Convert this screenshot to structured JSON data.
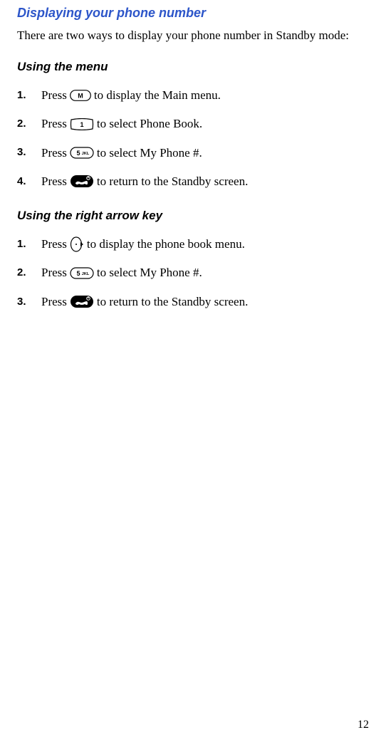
{
  "section": {
    "title": "Displaying your phone number",
    "intro": "There are two ways to display your phone number in Standby mode:"
  },
  "menu_method": {
    "heading": "Using the menu",
    "steps": [
      {
        "num": "1.",
        "pre": "Press ",
        "icon": "m-key",
        "post": " to display the Main menu."
      },
      {
        "num": "2.",
        "pre": "Press ",
        "icon": "key-1",
        "post": " to select Phone Book."
      },
      {
        "num": "3.",
        "pre": "Press ",
        "icon": "key-5jkl",
        "post": " to select My Phone #."
      },
      {
        "num": "4.",
        "pre": "Press ",
        "icon": "end-key",
        "post": " to return to the Standby screen."
      }
    ]
  },
  "arrow_method": {
    "heading": "Using the right arrow key",
    "steps": [
      {
        "num": "1.",
        "pre": "Press ",
        "icon": "right-arrow-key",
        "post": " to display the phone book menu."
      },
      {
        "num": "2.",
        "pre": "Press ",
        "icon": "key-5jkl",
        "post": " to select My Phone #."
      },
      {
        "num": "3.",
        "pre": "Press ",
        "icon": "end-key",
        "post": " to return to the Standby screen."
      }
    ]
  },
  "page_number": "12"
}
